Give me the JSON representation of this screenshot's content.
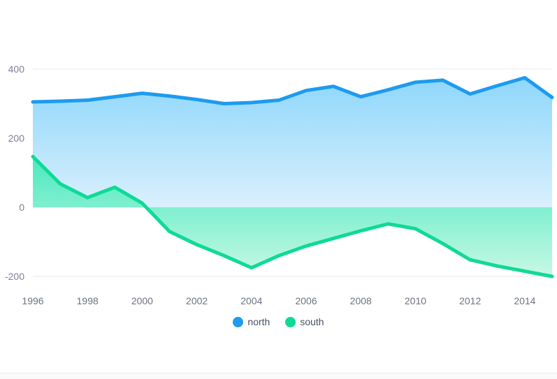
{
  "chart_data": {
    "type": "area",
    "title": "",
    "subtitle": "",
    "xlabel": "",
    "ylabel": "",
    "x": [
      1996,
      1997,
      1998,
      1999,
      2000,
      2001,
      2002,
      2003,
      2004,
      2005,
      2006,
      2007,
      2008,
      2009,
      2010,
      2011,
      2012,
      2013,
      2014,
      2015
    ],
    "xtick_labels": [
      "1996",
      "1998",
      "2000",
      "2002",
      "2004",
      "2006",
      "2008",
      "2010",
      "2012",
      "2014"
    ],
    "xtick_values": [
      1996,
      1998,
      2000,
      2002,
      2004,
      2006,
      2008,
      2010,
      2012,
      2014
    ],
    "ytick_labels": [
      "400",
      "200",
      "0",
      "-200"
    ],
    "ytick_values": [
      400,
      200,
      0,
      -200
    ],
    "ylim": [
      -240,
      430
    ],
    "xlim": [
      1996,
      2015
    ],
    "grid": true,
    "legend_position": "bottom-center",
    "series": [
      {
        "name": "north",
        "color": "#1d9bf0",
        "fill_top": "#8ed7fb",
        "fill_bottom": "#d9effd",
        "values": [
          305,
          307,
          310,
          320,
          330,
          322,
          312,
          300,
          303,
          310,
          338,
          350,
          320,
          340,
          362,
          368,
          328,
          352,
          375,
          318
        ]
      },
      {
        "name": "south",
        "color": "#0fda96",
        "fill_top": "#48e8bd",
        "fill_bottom": "#c4f7e3",
        "values": [
          147,
          68,
          28,
          58,
          12,
          -70,
          -108,
          -140,
          -175,
          -140,
          -112,
          -90,
          -68,
          -48,
          -62,
          -105,
          -152,
          -170,
          -185,
          -200
        ]
      }
    ]
  },
  "legend": {
    "items": [
      {
        "label": "north",
        "color": "#1d9bf0",
        "icon": "circle-marker-icon"
      },
      {
        "label": "south",
        "color": "#0fda96",
        "icon": "circle-marker-icon"
      }
    ]
  },
  "axis": {
    "y_labels": [
      "400",
      "200",
      "0",
      "-200"
    ],
    "x_labels": [
      "1996",
      "1998",
      "2000",
      "2002",
      "2004",
      "2006",
      "2008",
      "2010",
      "2012",
      "2014"
    ]
  }
}
